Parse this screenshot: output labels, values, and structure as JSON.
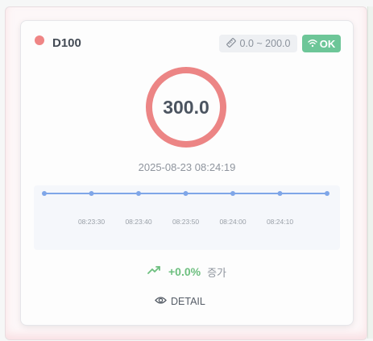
{
  "card": {
    "device_name": "D100",
    "status_color": "#ef8585",
    "range_icon": "ruler-icon",
    "range_label": "0.0 ~ 200.0",
    "connection_icon": "wifi-icon",
    "status_label": "OK",
    "value": "300.0",
    "timestamp": "2025-08-23 08:24:19",
    "trend_icon": "trending-up-icon",
    "trend_percent": "+0.0%",
    "trend_label": "증가",
    "detail_icon": "eye-icon",
    "detail_label": "DETAIL"
  },
  "chart_data": {
    "type": "line",
    "x": [
      "08:23:30",
      "08:23:40",
      "08:23:50",
      "08:24:00",
      "08:24:10"
    ],
    "series": [
      {
        "values": [
          300.0,
          300.0,
          300.0,
          300.0,
          300.0,
          300.0,
          300.0
        ]
      }
    ],
    "color": "#7fa6e8",
    "grid": false
  }
}
